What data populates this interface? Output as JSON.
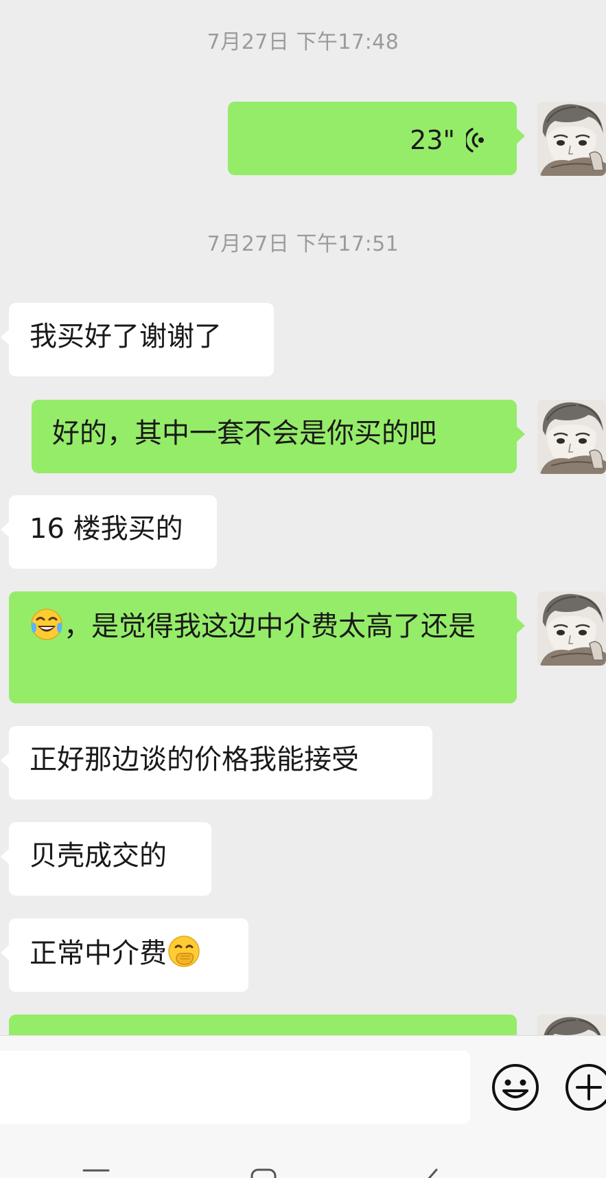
{
  "timestamps": [
    "7月27日 下午17:48",
    "7月27日 下午17:51"
  ],
  "voice_message": {
    "duration": "23\""
  },
  "messages": [
    {
      "side": "in",
      "text": "我买好了谢谢了"
    },
    {
      "side": "out",
      "text": "好的，其中一套不会是你买的吧"
    },
    {
      "side": "in",
      "text": "16 楼我买的"
    },
    {
      "side": "out",
      "emoji": "tears-of-joy-emoji",
      "text": "，是觉得我这边中介费太高了还是"
    },
    {
      "side": "in",
      "text": "正好那边谈的价格我能接受"
    },
    {
      "side": "in",
      "text": "贝壳成交的"
    },
    {
      "side": "in",
      "text": "正常中介费",
      "emoji": "hand-over-mouth-emoji"
    }
  ],
  "input_bar": {
    "icons": [
      "smiley-icon",
      "plus-icon"
    ]
  },
  "nav_bar": {
    "icons": [
      "menu-icon",
      "home-icon",
      "back-icon"
    ]
  },
  "colors": {
    "background": "#ededed",
    "outgoing_bubble": "#95ec69",
    "incoming_bubble": "#ffffff",
    "timestamp": "#9b9b9b"
  }
}
